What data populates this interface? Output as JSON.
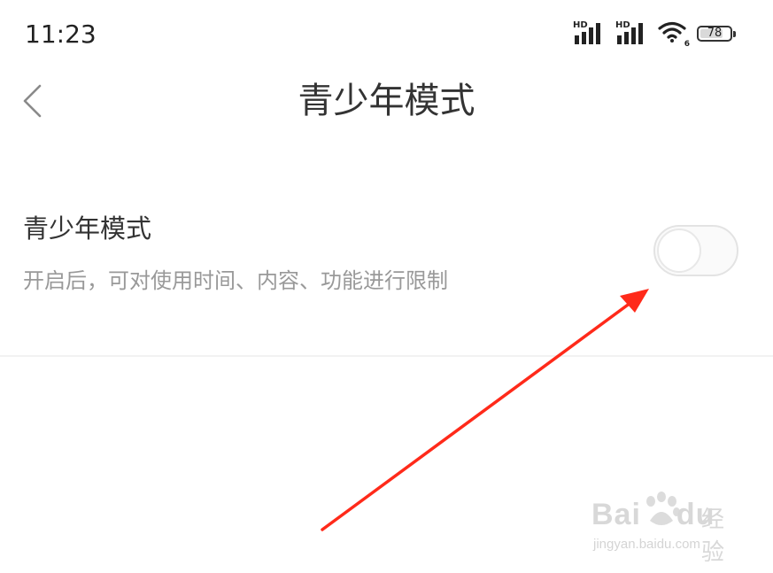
{
  "status_bar": {
    "time": "11:23",
    "sim1_label": "HD",
    "sim2_label": "HD",
    "wifi_sub": "6",
    "battery_level": "78",
    "battery_fraction": 0.78
  },
  "header": {
    "title": "青少年模式",
    "back_icon": "chevron-left-icon"
  },
  "setting": {
    "title": "青少年模式",
    "description": "开启后，可对使用时间、内容、功能进行限制",
    "toggle_state": "off"
  },
  "annotation": {
    "arrow_color": "#ff2a1a"
  },
  "watermark": {
    "brand": "Bai",
    "brand_suffix": "du",
    "brand_cn": "经验",
    "url": "jingyan.baidu.com"
  },
  "colors": {
    "background": "#ffffff",
    "text_primary": "#333333",
    "text_secondary": "#999999",
    "toggle_border": "#e3e3e3"
  }
}
